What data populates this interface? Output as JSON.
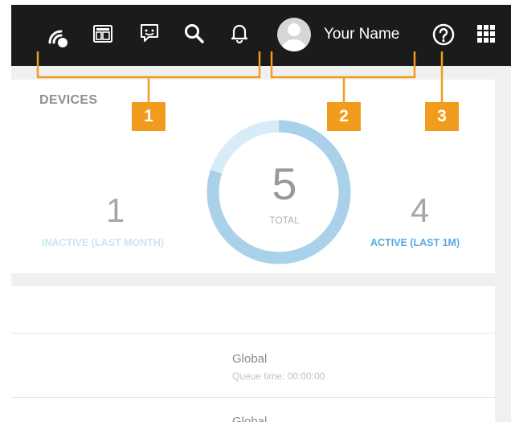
{
  "topbar": {
    "icons": [
      "connect-icon",
      "dashboard-icon",
      "feedback-icon",
      "search-icon",
      "bell-icon"
    ],
    "user_name": "Your Name",
    "help_icon": "help-icon",
    "apps_icon": "apps-grid-icon"
  },
  "devices": {
    "title": "DEVICES",
    "inactive_count": "1",
    "inactive_label": "INACTIVE (LAST MONTH)",
    "total_count": "5",
    "total_label": "TOTAL",
    "active_count": "4",
    "active_label": "ACTIVE (LAST 1M)",
    "active_fraction": 0.8
  },
  "list": {
    "rows": [
      {
        "title": "Global",
        "subtitle": "Queue time: 00:00:00"
      },
      {
        "title": "Global"
      }
    ]
  },
  "callouts": [
    "1",
    "2",
    "3"
  ],
  "colors": {
    "topbar": "#1b1b1b",
    "accent_orange": "#f19c1d",
    "donut_active": "#a9d1ea",
    "donut_inactive": "#d8ecf8",
    "active_label": "#5aa9df",
    "inactive_label": "#c9e6f6"
  }
}
